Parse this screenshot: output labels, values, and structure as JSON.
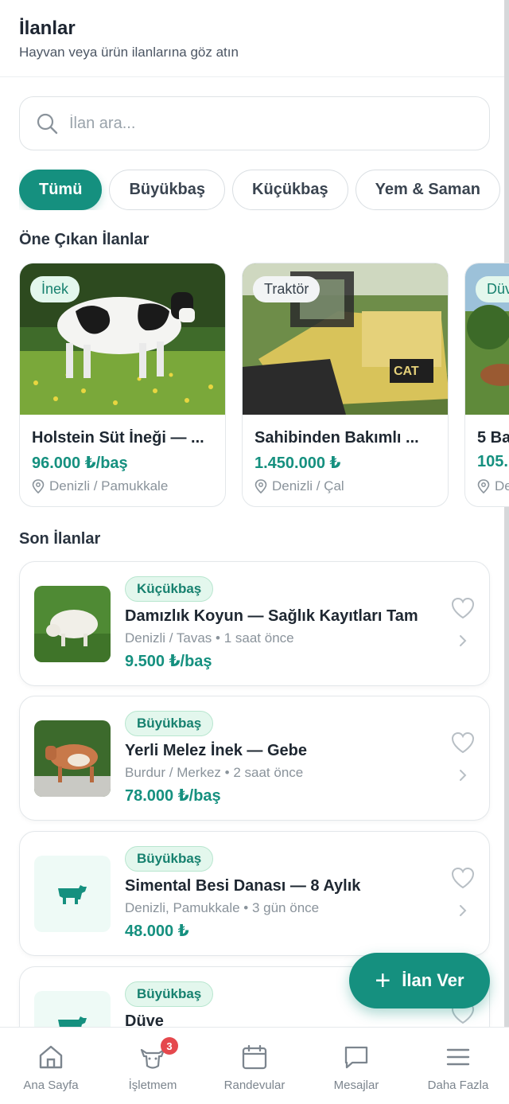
{
  "header": {
    "title": "İlanlar",
    "subtitle": "Hayvan veya ürün ilanlarına göz atın"
  },
  "search": {
    "placeholder": "İlan ara..."
  },
  "filters": [
    "Tümü",
    "Büyükbaş",
    "Küçükbaş",
    "Yem & Saman"
  ],
  "active_filter": "Tümü",
  "featured": {
    "title": "Öne Çıkan İlanlar",
    "items": [
      {
        "tag": "İnek",
        "name": "Holstein Süt İneği — ...",
        "price": "96.000 ₺/baş",
        "location": "Denizli / Pamukkale",
        "image": "holstein-cow"
      },
      {
        "tag": "Traktör",
        "name": "Sahibinden Bakımlı ...",
        "price": "1.450.000 ₺",
        "location": "Denizli / Çal",
        "image": "cat-tractor"
      },
      {
        "tag": "Düv",
        "name": "5 Ba",
        "price": "105.",
        "location": "De",
        "image": "cattle-field"
      }
    ]
  },
  "recent": {
    "title": "Son İlanlar",
    "items": [
      {
        "badge": "Küçükbaş",
        "title": "Damızlık Koyun — Sağlık Kayıtları Tam",
        "location": "Denizli / Tavas",
        "time": "1 saat önce",
        "price": "9.500 ₺/baş",
        "image": "sheep"
      },
      {
        "badge": "Büyükbaş",
        "title": "Yerli Melez İnek — Gebe",
        "location": "Burdur / Merkez",
        "time": "2 saat önce",
        "price": "78.000 ₺/baş",
        "image": "brown-cow"
      },
      {
        "badge": "Büyükbaş",
        "title": "Simental Besi Danası — 8 Aylık",
        "location": "Denizli, Pamukkale",
        "time": "3 gün önce",
        "price": "48.000 ₺",
        "image": "placeholder-cow-icon"
      },
      {
        "badge": "Büyükbaş",
        "title": "Düve",
        "image": "placeholder-cow-icon"
      }
    ]
  },
  "fab": {
    "label": "İlan Ver"
  },
  "nav": {
    "items": [
      {
        "label": "Ana Sayfa",
        "icon": "home-icon"
      },
      {
        "label": "İşletmem",
        "icon": "cow-head-icon",
        "badge": "3"
      },
      {
        "label": "Randevular",
        "icon": "calendar-icon"
      },
      {
        "label": "Mesajlar",
        "icon": "message-icon"
      },
      {
        "label": "Daha Fazla",
        "icon": "menu-icon"
      }
    ]
  },
  "colors": {
    "accent": "#15907f",
    "badge_bg": "#e3f7ed",
    "badge_text": "#17816f",
    "notification": "#e5484d"
  }
}
